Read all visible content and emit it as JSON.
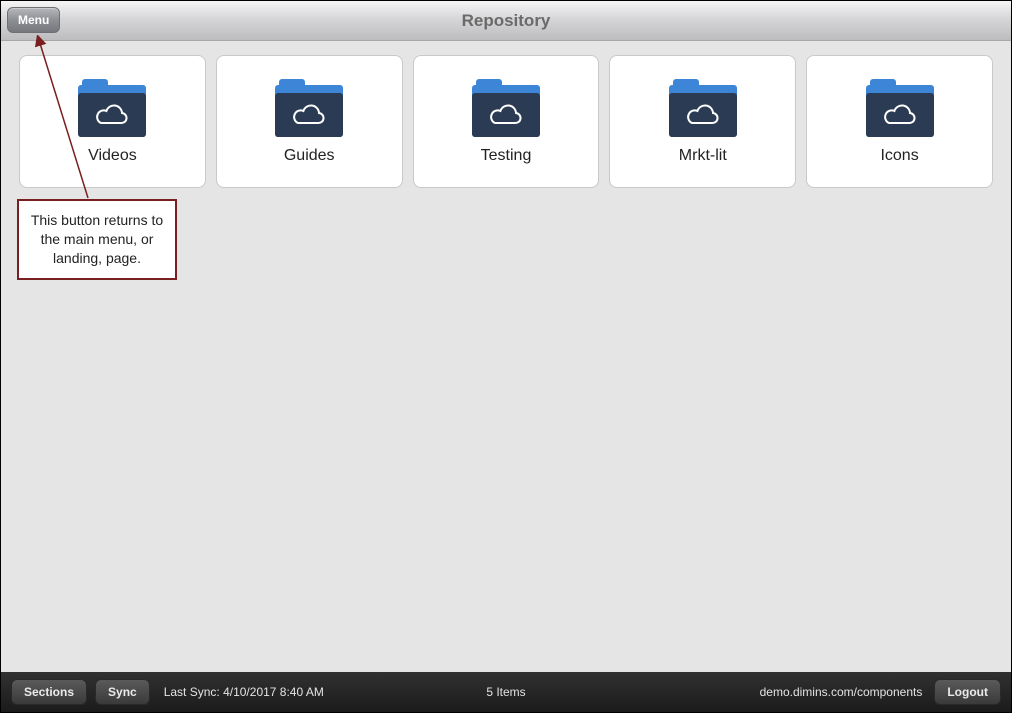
{
  "header": {
    "menu_label": "Menu",
    "title": "Repository"
  },
  "folders": [
    {
      "label": "Videos"
    },
    {
      "label": "Guides"
    },
    {
      "label": "Testing"
    },
    {
      "label": "Mrkt-lit"
    },
    {
      "label": "Icons"
    }
  ],
  "callout": {
    "text": "This button returns to the main menu, or landing, page."
  },
  "footer": {
    "sections_label": "Sections",
    "sync_label": "Sync",
    "last_sync_prefix": "Last Sync: ",
    "last_sync_time": "4/10/2017 8:40 AM",
    "item_count_text": "5 Items",
    "url": "demo.dimins.com/components",
    "logout_label": "Logout"
  }
}
